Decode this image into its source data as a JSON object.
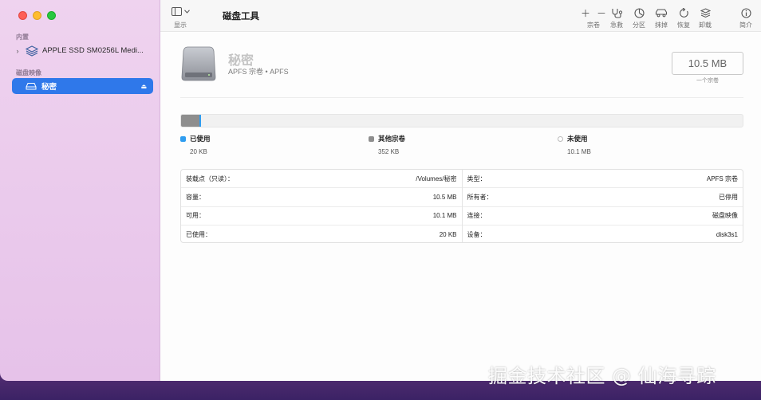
{
  "sidebar": {
    "section_internal": "内置",
    "drive_name": "APPLE SSD SM0256L Medi...",
    "section_images": "磁盘映像",
    "selected_volume": "秘密"
  },
  "toolbar": {
    "show_label": "显示",
    "title": "磁盘工具",
    "volume_label": "宗卷",
    "first_aid_label": "急救",
    "partition_label": "分区",
    "erase_label": "抹掉",
    "restore_label": "恢复",
    "unmount_label": "卸载",
    "info_label": "简介"
  },
  "volume": {
    "name": "秘密",
    "subtitle": "APFS 宗卷 • APFS",
    "size": "10.5 MB",
    "size_caption": "一个宗卷"
  },
  "usage": {
    "used_label": "已使用",
    "used_value": "20 KB",
    "used_color": "#2f9df0",
    "other_label": "其他宗卷",
    "other_value": "352 KB",
    "other_color": "#8e8e8e",
    "free_label": "未使用",
    "free_value": "10.1 MB",
    "other_fraction": 0.033,
    "used_fraction": 0.002
  },
  "details": {
    "left": [
      {
        "label": "装载点（只读）：",
        "value": "/Volumes/秘密"
      },
      {
        "label": "容量：",
        "value": "10.5 MB"
      },
      {
        "label": "可用：",
        "value": "10.1 MB"
      },
      {
        "label": "已使用：",
        "value": "20 KB"
      }
    ],
    "right": [
      {
        "label": "类型：",
        "value": "APFS 宗卷"
      },
      {
        "label": "所有者：",
        "value": "已停用"
      },
      {
        "label": "连接：",
        "value": "磁盘映像"
      },
      {
        "label": "设备：",
        "value": "disk3s1"
      }
    ]
  },
  "watermark": "掘金技术社区 @ 仙海寻踪"
}
